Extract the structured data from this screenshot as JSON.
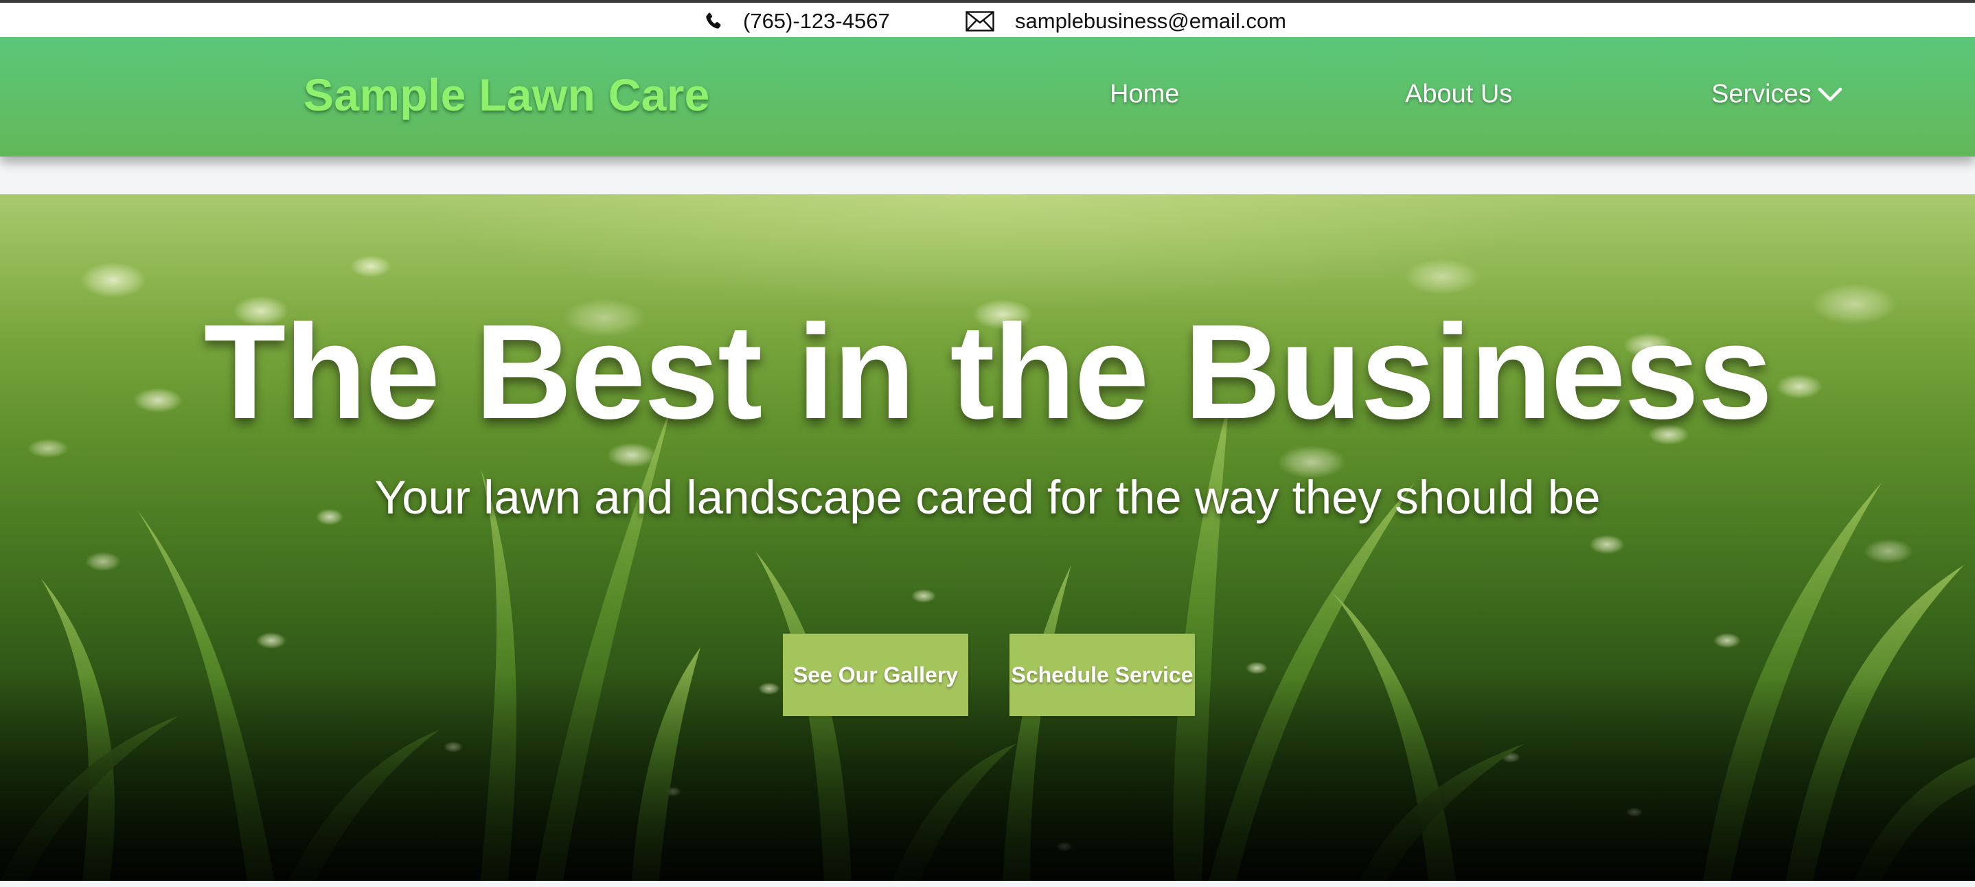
{
  "topbar": {
    "phone": "(765)-123-4567",
    "phone_icon": "phone-icon",
    "email": "samplebusiness@email.com",
    "email_icon": "envelope-icon"
  },
  "header": {
    "logo": "Sample Lawn Care",
    "nav": {
      "home": "Home",
      "about": "About Us",
      "services": "Services"
    },
    "services_icon": "chevron-down-icon"
  },
  "hero": {
    "title": "The Best in the Business",
    "subtitle": "Your lawn and landscape cared for the way they should be",
    "buttons": {
      "gallery": "See Our Gallery",
      "schedule": "Schedule Service"
    },
    "background": "grass-photo"
  },
  "colors": {
    "header_green": "#5fbf68",
    "logo_green": "#8ff06e",
    "button_green": "#a4c45c"
  }
}
